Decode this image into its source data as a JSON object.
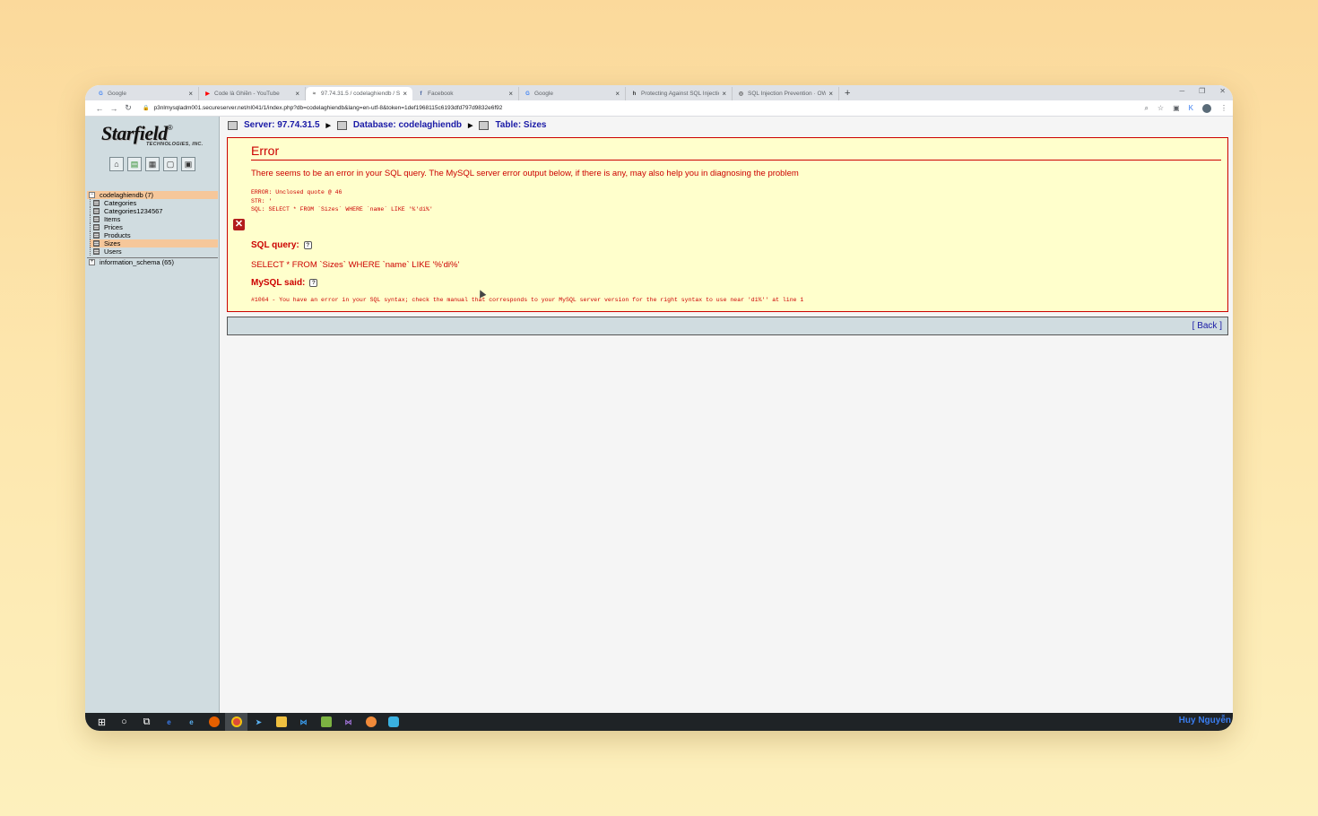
{
  "browser": {
    "tabs": [
      {
        "title": "Google",
        "icon": "G",
        "color": "#4285f4"
      },
      {
        "title": "Code là Ghiền - YouTube",
        "icon": "▶",
        "color": "#ff0000"
      },
      {
        "title": "97.74.31.5 / codelaghiendb / Si...",
        "icon": "≈",
        "color": "#555555",
        "active": true
      },
      {
        "title": "Facebook",
        "icon": "f",
        "color": "#3b5998"
      },
      {
        "title": "Google",
        "icon": "G",
        "color": "#4285f4"
      },
      {
        "title": "Protecting Against SQL Injection",
        "icon": "h",
        "color": "#333333"
      },
      {
        "title": "SQL Injection Prevention · OWA...",
        "icon": "◎",
        "color": "#555555"
      }
    ],
    "new_tab": "+",
    "url": "p3nlmysqladm001.secureserver.net/nl041/1/index.php?db=codelaghiendb&lang=en-utf-8&token=1def1968115c6193dfd797d9832e6f92"
  },
  "sidebar": {
    "logo_text": "Starfield",
    "logo_reg": "®",
    "logo_sub": "TECHNOLOGIES, INC.",
    "tools": [
      "⌂",
      "▤",
      "▦",
      "▢",
      "▣"
    ],
    "db_name": "codelaghiendb (7)",
    "tables": [
      "Categories",
      "Categories1234567",
      "Items",
      "Prices",
      "Products",
      "Sizes",
      "Users"
    ],
    "selected_table": "Sizes",
    "other_db": "information_schema (65)"
  },
  "breadcrumb": {
    "server": "Server: 97.74.31.5",
    "database": "Database: codelaghiendb",
    "table": "Table: Sizes"
  },
  "error": {
    "title": "Error",
    "intro": "There seems to be an error in your SQL query. The MySQL server error output below, if there is any, may also help you in diagnosing the problem",
    "code_lines": "ERROR: Unclosed quote @ 46\nSTR: '\nSQL: SELECT * FROM `Sizes` WHERE `name` LIKE '%'di%'",
    "sql_query_label": "SQL query:",
    "sql_query": "SELECT * FROM `Sizes` WHERE `name` LIKE '%'di%'",
    "mysql_said_label": "MySQL said:",
    "mysql_said": "#1064 - You have an error in your SQL syntax; check the manual that corresponds to your MySQL server version for the right syntax to use near 'di%'' at line 1",
    "help_glyph": "?"
  },
  "back_label": "[ Back ]",
  "taskbar": {
    "user": "Huy Nguyễn"
  }
}
